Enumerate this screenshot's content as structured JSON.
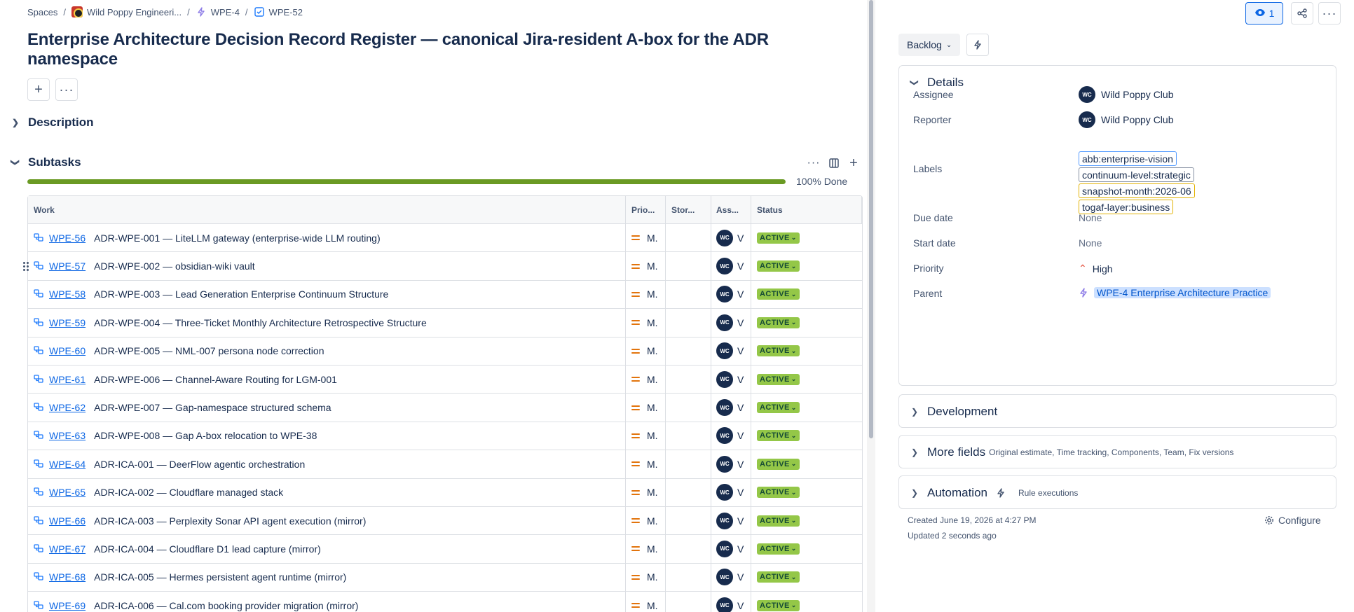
{
  "breadcrumb": {
    "spaces": "Spaces",
    "space_name": "Wild Poppy Engineeri...",
    "parent_key": "WPE-4",
    "issue_key": "WPE-52"
  },
  "issue": {
    "title": "Enterprise Architecture Decision Record Register — canonical Jira-resident A-box for the ADR namespace"
  },
  "sections": {
    "description": "Description",
    "subtasks": "Subtasks"
  },
  "progress": {
    "percent_done": 100,
    "label": "100% Done"
  },
  "table": {
    "headers": {
      "work": "Work",
      "priority": "Prio...",
      "story_points": "Stor...",
      "assignee": "Ass...",
      "status": "Status"
    },
    "rows": [
      {
        "key": "WPE-56",
        "summary": "ADR-WPE-001 — LiteLLM gateway (enterprise-wide LLM routing)",
        "priority": "M.",
        "assignee_initials": "WC",
        "assignee": "V",
        "status": "ACTIVE"
      },
      {
        "key": "WPE-57",
        "summary": "ADR-WPE-002 — obsidian-wiki vault",
        "priority": "M.",
        "assignee_initials": "WC",
        "assignee": "V",
        "status": "ACTIVE"
      },
      {
        "key": "WPE-58",
        "summary": "ADR-WPE-003 — Lead Generation Enterprise Continuum Structure",
        "priority": "M.",
        "assignee_initials": "WC",
        "assignee": "V",
        "status": "ACTIVE"
      },
      {
        "key": "WPE-59",
        "summary": "ADR-WPE-004 — Three-Ticket Monthly Architecture Retrospective Structure",
        "priority": "M.",
        "assignee_initials": "WC",
        "assignee": "V",
        "status": "ACTIVE"
      },
      {
        "key": "WPE-60",
        "summary": "ADR-WPE-005 — NML-007 persona node correction",
        "priority": "M.",
        "assignee_initials": "WC",
        "assignee": "V",
        "status": "ACTIVE"
      },
      {
        "key": "WPE-61",
        "summary": "ADR-WPE-006 — Channel-Aware Routing for LGM-001",
        "priority": "M.",
        "assignee_initials": "WC",
        "assignee": "V",
        "status": "ACTIVE"
      },
      {
        "key": "WPE-62",
        "summary": "ADR-WPE-007 — Gap-namespace structured schema",
        "priority": "M.",
        "assignee_initials": "WC",
        "assignee": "V",
        "status": "ACTIVE"
      },
      {
        "key": "WPE-63",
        "summary": "ADR-WPE-008 — Gap A-box relocation to WPE-38",
        "priority": "M.",
        "assignee_initials": "WC",
        "assignee": "V",
        "status": "ACTIVE"
      },
      {
        "key": "WPE-64",
        "summary": "ADR-ICA-001 — DeerFlow agentic orchestration",
        "priority": "M.",
        "assignee_initials": "WC",
        "assignee": "V",
        "status": "ACTIVE"
      },
      {
        "key": "WPE-65",
        "summary": "ADR-ICA-002 — Cloudflare managed stack",
        "priority": "M.",
        "assignee_initials": "WC",
        "assignee": "V",
        "status": "ACTIVE"
      },
      {
        "key": "WPE-66",
        "summary": "ADR-ICA-003 — Perplexity Sonar API agent execution (mirror)",
        "priority": "M.",
        "assignee_initials": "WC",
        "assignee": "V",
        "status": "ACTIVE"
      },
      {
        "key": "WPE-67",
        "summary": "ADR-ICA-004 — Cloudflare D1 lead capture (mirror)",
        "priority": "M.",
        "assignee_initials": "WC",
        "assignee": "V",
        "status": "ACTIVE"
      },
      {
        "key": "WPE-68",
        "summary": "ADR-ICA-005 — Hermes persistent agent runtime (mirror)",
        "priority": "M.",
        "assignee_initials": "WC",
        "assignee": "V",
        "status": "ACTIVE"
      },
      {
        "key": "WPE-69",
        "summary": "ADR-ICA-006 — Cal.com booking provider migration (mirror)",
        "priority": "M.",
        "assignee_initials": "WC",
        "assignee": "V",
        "status": "ACTIVE"
      }
    ]
  },
  "side": {
    "watch_count": "1",
    "status": "Backlog",
    "details": {
      "title": "Details",
      "assignee_label": "Assignee",
      "assignee_initials": "WC",
      "assignee": "Wild Poppy Club",
      "reporter_label": "Reporter",
      "reporter_initials": "WC",
      "reporter": "Wild Poppy Club",
      "labels_label": "Labels",
      "labels": [
        "abb:enterprise-vision",
        "continuum-level:strategic",
        "snapshot-month:2026-06",
        "togaf-layer:business"
      ],
      "label_colors": [
        "#579dff",
        "#8590a2",
        "#e2b203",
        "#e2b203"
      ],
      "due_date_label": "Due date",
      "due_date": "None",
      "start_date_label": "Start date",
      "start_date": "None",
      "priority_label": "Priority",
      "priority": "High",
      "parent_label": "Parent",
      "parent": "WPE-4 Enterprise Architecture Practice"
    },
    "development": "Development",
    "more_fields": "More fields",
    "more_fields_sub": "Original estimate, Time tracking, Components, Team, Fix versions",
    "automation": "Automation",
    "automation_sub": "Rule executions",
    "created": "Created June 19, 2026 at 4:27 PM",
    "updated": "Updated 2 seconds ago",
    "configure": "Configure"
  },
  "colors": {
    "accent": "#0c66e4",
    "progress": "#6a9a23",
    "status_active": "#94c748",
    "priority_medium": "#e2740d",
    "priority_high": "#e34935"
  }
}
